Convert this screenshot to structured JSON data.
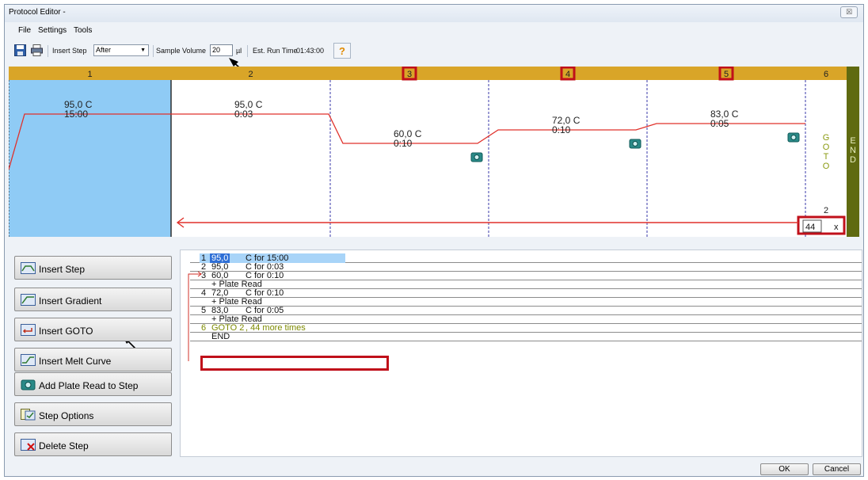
{
  "window": {
    "title": "Protocol Editor -",
    "close_glyph": "☒"
  },
  "menu": {
    "items": [
      "File",
      "Settings",
      "Tools"
    ]
  },
  "toolbar": {
    "save_icon": "save-icon",
    "print_icon": "print-icon",
    "insert_step_label": "Insert Step",
    "insert_step_value": "After",
    "sample_volume_label": "Sample Volume",
    "sample_volume_value": "20",
    "sample_volume_unit": "µl",
    "run_time_label": "Est. Run Time",
    "run_time_value": "01:43:00",
    "help_label": "?"
  },
  "graph": {
    "header_color": "#d9a528",
    "selected_color": "#8fcbf5",
    "line_color": "#e0302a",
    "end_color": "#5f6a10",
    "highlight_color": "#c0101a",
    "steps": [
      {
        "number": "1",
        "temp": "95,0",
        "unit": "C",
        "time": "15:00",
        "highlighted": false,
        "plate_read": false
      },
      {
        "number": "2",
        "temp": "95,0",
        "unit": "C",
        "time": "0:03",
        "highlighted": false,
        "plate_read": false
      },
      {
        "number": "3",
        "temp": "60,0",
        "unit": "C",
        "time": "0:10",
        "highlighted": true,
        "plate_read": true
      },
      {
        "number": "4",
        "temp": "72,0",
        "unit": "C",
        "time": "0:10",
        "highlighted": true,
        "plate_read": true
      },
      {
        "number": "5",
        "temp": "83,0",
        "unit": "C",
        "time": "0:05",
        "highlighted": true,
        "plate_read": true
      }
    ],
    "goto": {
      "number": "6",
      "label_letters": [
        "G",
        "O",
        "T",
        "O"
      ],
      "target": "2",
      "repeat_value": "44",
      "repeat_clear": "x"
    },
    "end_letters": [
      "E",
      "N",
      "D"
    ]
  },
  "side_buttons": [
    {
      "label": "Insert Step",
      "icon": "insert-step-icon"
    },
    {
      "label": "Insert Gradient",
      "icon": "insert-gradient-icon"
    },
    {
      "label": "Insert GOTO",
      "icon": "insert-goto-icon"
    },
    {
      "label": "Insert Melt Curve",
      "icon": "insert-melt-curve-icon"
    },
    {
      "label": "Add Plate Read to Step",
      "icon": "camera-icon"
    },
    {
      "label": "Step Options",
      "icon": "step-options-icon"
    },
    {
      "label": "Delete Step",
      "icon": "delete-step-icon"
    }
  ],
  "protocol_list": [
    {
      "num": "1",
      "temp": "95,0",
      "rest": "C  for 15:00",
      "selected": true
    },
    {
      "num": "2",
      "temp": "95,0",
      "rest": "C  for 0:03"
    },
    {
      "num": "3",
      "temp": "60,0",
      "rest": "C  for 0:10"
    },
    {
      "num": "",
      "temp": "+ Plate Read",
      "rest": ""
    },
    {
      "num": "4",
      "temp": "72,0",
      "rest": "C  for 0:10"
    },
    {
      "num": "",
      "temp": "+ Plate Read",
      "rest": ""
    },
    {
      "num": "5",
      "temp": "83,0",
      "rest": "C  for 0:05"
    },
    {
      "num": "",
      "temp": "+ Plate Read",
      "rest": ""
    },
    {
      "num": "6",
      "temp": "GOTO 2",
      "rest": ",  44        more times",
      "goto": true
    },
    {
      "num": "",
      "temp": "END",
      "rest": ""
    }
  ],
  "footer": {
    "ok": "OK",
    "cancel": "Cancel"
  }
}
